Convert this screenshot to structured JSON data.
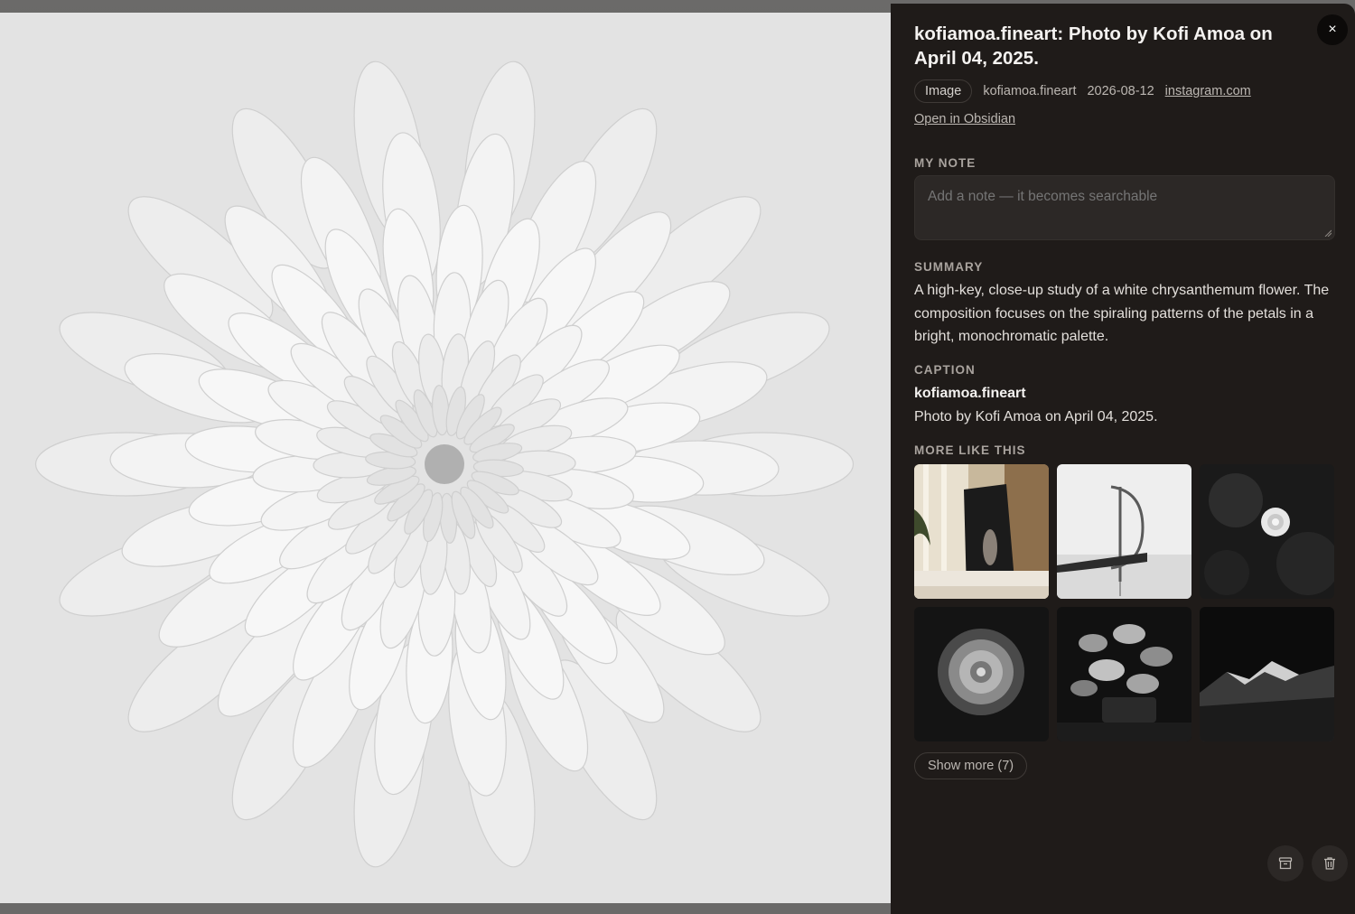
{
  "header": {
    "title": "kofiamoa.fineart: Photo by Kofi Amoa on April 04, 2025.",
    "close_icon": "×"
  },
  "meta": {
    "type_chip": "Image",
    "author": "kofiamoa.fineart",
    "date": "2026-08-12",
    "source_link": "instagram.com",
    "open_link": "Open in Obsidian"
  },
  "note": {
    "label": "MY NOTE",
    "placeholder": "Add a note — it becomes searchable",
    "value": ""
  },
  "summary": {
    "label": "SUMMARY",
    "text": "A high-key, close-up study of a white chrysanthemum flower. The composition focuses on the spiraling patterns of the petals in a bright, monochromatic palette."
  },
  "caption": {
    "label": "CAPTION",
    "user": "kofiamoa.fineart",
    "text": "Photo by Kofi Amoa on April 04, 2025."
  },
  "related": {
    "label": "MORE LIKE THIS",
    "items": [
      {
        "kind": "interior-portrait"
      },
      {
        "kind": "sculpture-seascape"
      },
      {
        "kind": "white-rose"
      },
      {
        "kind": "dahlia"
      },
      {
        "kind": "plant-leaves"
      },
      {
        "kind": "mountain"
      }
    ],
    "show_more": "Show more (7)"
  },
  "actions": {
    "archive_icon": "archive-icon",
    "delete_icon": "trash-icon"
  },
  "colors": {
    "panel_bg": "#1f1b19",
    "input_bg": "#2c2826",
    "text_primary": "#f4f2f0",
    "text_muted": "#a9a39e"
  }
}
